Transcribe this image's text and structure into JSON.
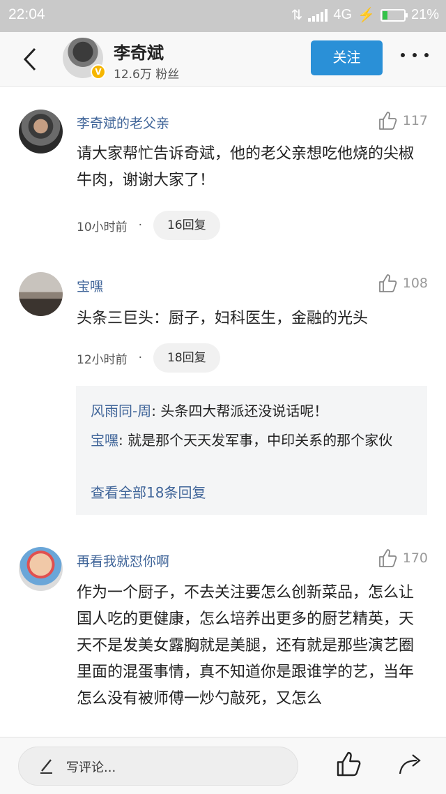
{
  "status_bar": {
    "time": "22:04",
    "network": "4G",
    "battery": "21%",
    "battery_level": 0.21
  },
  "header": {
    "author_name": "李奇斌",
    "fans": "12.6万 粉丝",
    "follow_label": "关注"
  },
  "comments": [
    {
      "name": "李奇斌的老父亲",
      "likes": "117",
      "text": "请大家帮忙告诉奇斌，他的老父亲想吃他烧的尖椒牛肉，谢谢大家了！",
      "time": "10小时前",
      "dot": "·",
      "replies": "16回复"
    },
    {
      "name": "宝嘿",
      "likes": "108",
      "text": "头条三巨头：厨子，妇科医生，金融的光头",
      "time": "12小时前",
      "dot": "·",
      "replies": "18回复",
      "sub_replies": [
        {
          "name": "风雨同-周",
          "sep": ": ",
          "text": "头条四大帮派还没说话呢！"
        },
        {
          "name": "宝嘿",
          "sep": ": ",
          "text": "就是那个天天发军事，中印关系的那个家伙"
        }
      ],
      "view_all": "查看全部18条回复"
    },
    {
      "name": "再看我就怼你啊",
      "likes": "170",
      "text": "作为一个厨子，不去关注要怎么创新菜品，怎么让国人吃的更健康，怎么培养出更多的厨艺精英，天天不是发美女露胸就是美腿，还有就是那些演艺圈里面的混蛋事情，真不知道你是跟谁学的艺，当年怎么没有被师傅一炒勺敲死，又怎么"
    }
  ],
  "bottom_bar": {
    "comment_placeholder": "写评论..."
  },
  "icons": [
    "back-arrow-icon",
    "more-dots-icon",
    "verified-badge-icon",
    "thumbs-up-icon",
    "pen-icon",
    "share-icon",
    "signal-icon",
    "battery-icon"
  ],
  "colors": {
    "accent": "#2a90d7",
    "username": "#406599"
  }
}
